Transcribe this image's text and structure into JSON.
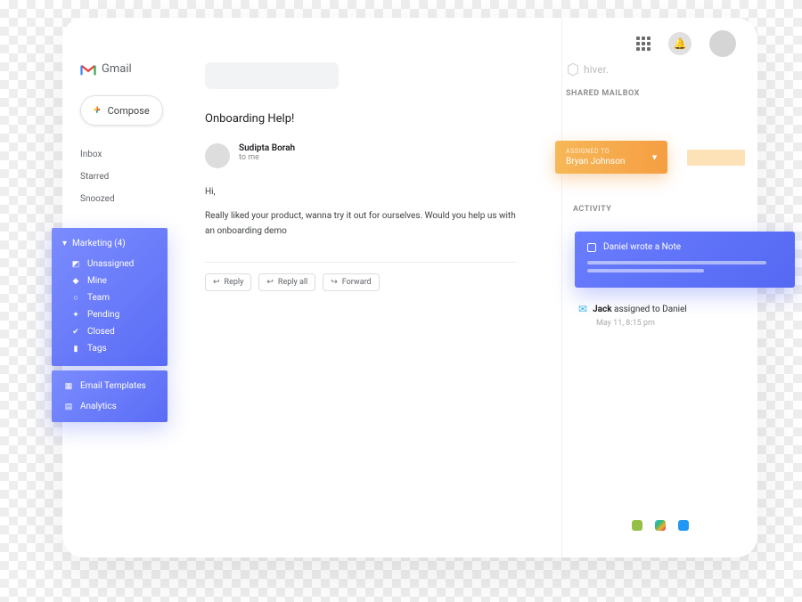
{
  "header": {
    "brand": "Gmail"
  },
  "compose": {
    "label": "Compose"
  },
  "sideLinks": {
    "item0": "Inbox",
    "item1": "Starred",
    "item2": "Snoozed"
  },
  "marketing": {
    "header": "Marketing (4)",
    "item0": "Unassigned",
    "item1": "Mine",
    "item2": "Team",
    "item3": "Pending",
    "item4": "Closed",
    "item5": "Tags"
  },
  "extras": {
    "item0": "Email Templates",
    "item1": "Analytics"
  },
  "mail": {
    "subject": "Onboarding Help!",
    "senderName": "Sudipta Borah",
    "senderSub": "to me",
    "greeting": "Hi,",
    "body": "Really liked your product, wanna try it out for ourselves. Would you help us with an onboarding demo",
    "reply": "Reply",
    "replyAll": "Reply all",
    "forward": "Forward"
  },
  "hiver": {
    "brand": "hiver.",
    "sharedMailbox": "SHARED MAILBOX",
    "assignLabel": "ASSIGNED TO",
    "assignName": "Bryan Johnson",
    "activityLabel": "ACTIVITY",
    "noteText": "Daniel wrote a Note",
    "actJackBold": "Jack",
    "actJackText": " assigned to Daniel",
    "actTime": "May 11, 8:15 pm"
  }
}
